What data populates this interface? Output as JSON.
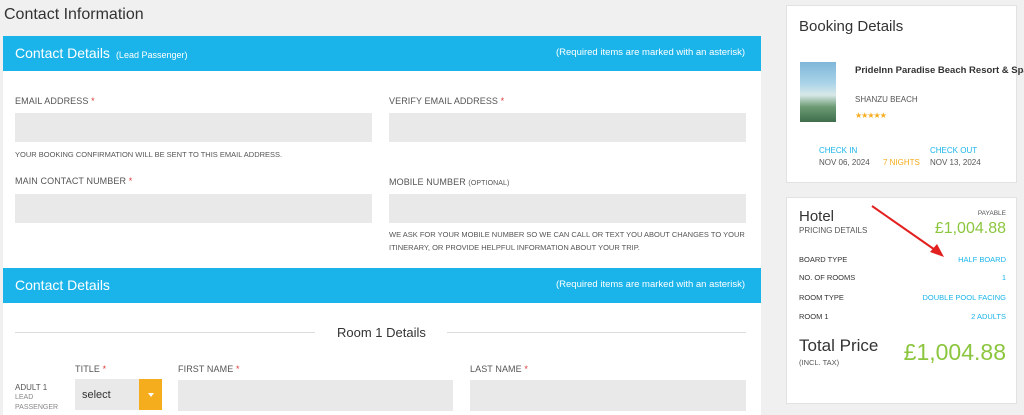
{
  "page_title": "Contact Information",
  "contact_section": {
    "title": "Contact Details",
    "subtitle": "(Lead Passenger)",
    "required_note": "(Required items are marked with an asterisk)",
    "email_label": "EMAIL ADDRESS",
    "verify_email_label": "VERIFY EMAIL ADDRESS",
    "email_note": "YOUR BOOKING CONFIRMATION WILL BE SENT TO THIS EMAIL ADDRESS.",
    "main_contact_label": "MAIN CONTACT NUMBER",
    "mobile_label": "MOBILE NUMBER",
    "mobile_optional": "(OPTIONAL)",
    "mobile_note": "WE ASK FOR YOUR MOBILE NUMBER SO WE CAN CALL OR TEXT YOU ABOUT CHANGES TO YOUR ITINERARY, OR PROVIDE HELPFUL INFORMATION ABOUT YOUR TRIP.",
    "asterisk": "*"
  },
  "passenger_section": {
    "title": "Contact Details",
    "required_note": "(Required items are marked with an asterisk)",
    "room_title": "Room 1 Details",
    "adult_label": "ADULT 1",
    "adult_sub_1": "LEAD",
    "adult_sub_2": "PASSENGER",
    "title_label": "TITLE",
    "first_name_label": "FIRST NAME",
    "last_name_label": "LAST NAME",
    "title_select_value": "select"
  },
  "booking": {
    "title": "Booking Details",
    "hotel_name": "PrideInn Paradise Beach Resort & Spa",
    "location": "SHANZU BEACH",
    "stars": "★★★★★",
    "check_in_label": "CHECK IN",
    "check_in_date": "NOV 06, 2024",
    "nights": "7 NIGHTS",
    "check_out_label": "CHECK OUT",
    "check_out_date": "NOV 13, 2024"
  },
  "pricing": {
    "title": "Hotel",
    "subtitle": "PRICING DETAILS",
    "payable_label": "PAYABLE",
    "price": "£1,004.88",
    "rows": [
      {
        "label": "BOARD TYPE",
        "value": "HALF BOARD"
      },
      {
        "label": "NO. OF ROOMS",
        "value": "1"
      },
      {
        "label": "ROOM TYPE",
        "value": "DOUBLE POOL FACING"
      },
      {
        "label": "ROOM 1",
        "value": "2 ADULTS"
      }
    ],
    "total_label": "Total Price",
    "total_sub": "(INCL. TAX)",
    "total_price": "£1,004.88"
  },
  "colors": {
    "accent": "#1ab4ea",
    "price": "#8cc63f",
    "select_button": "#f6ad1d",
    "required": "#e03a3a",
    "arrow": "#e32020"
  }
}
